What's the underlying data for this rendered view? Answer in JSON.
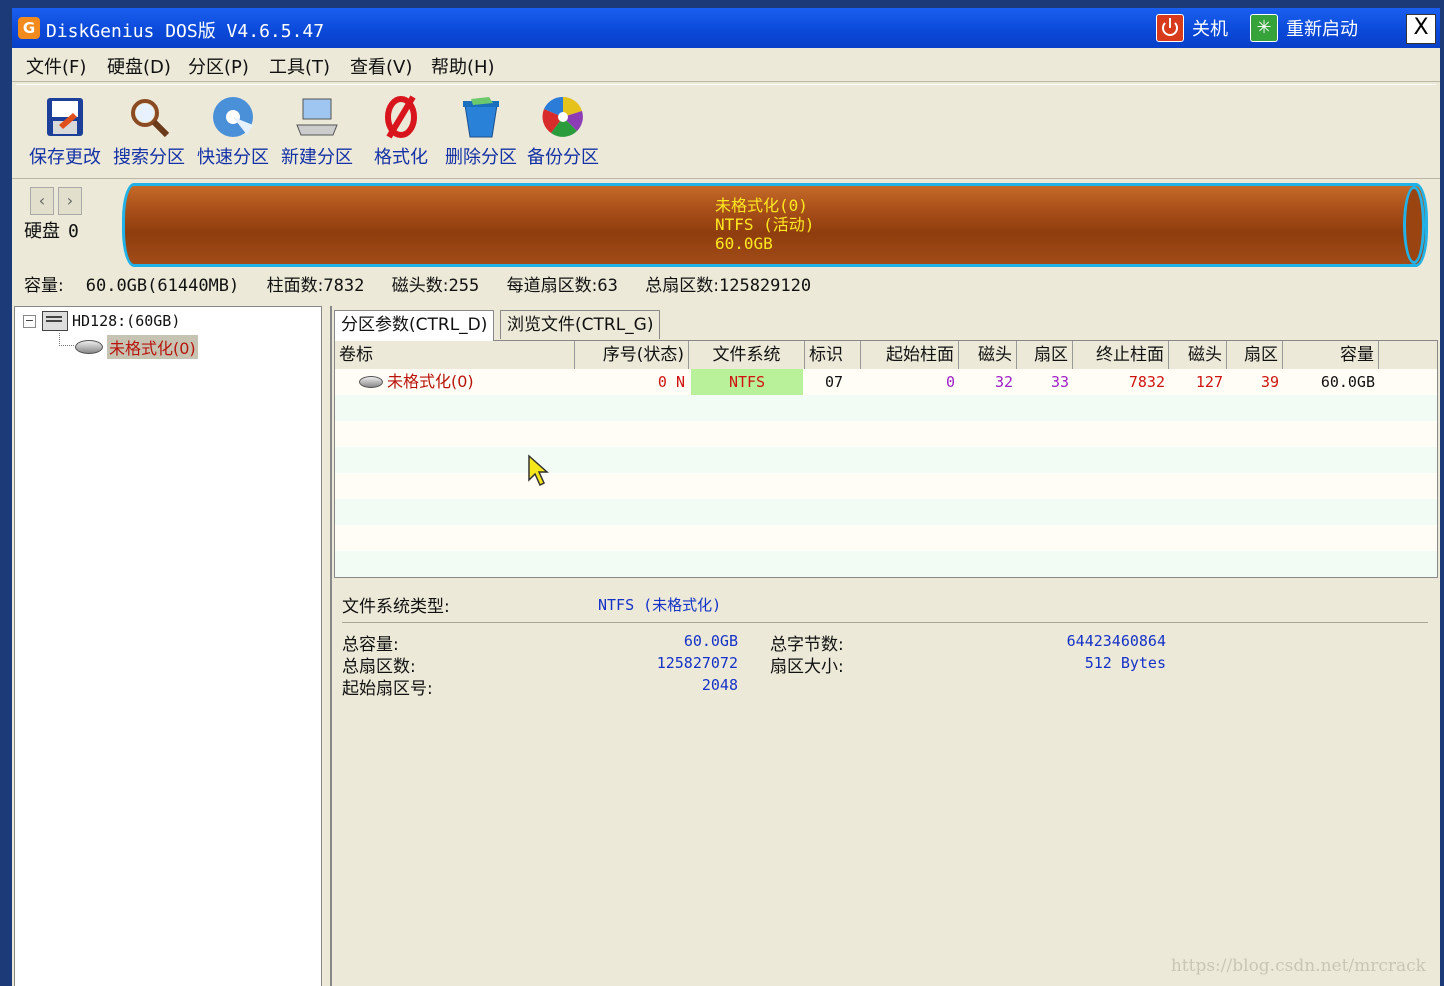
{
  "window": {
    "title": "DiskGenius DOS版 V4.6.5.47",
    "app_icon": "G",
    "shutdown_label": "关机",
    "restart_label": "重新启动",
    "close_label": "X"
  },
  "menu": [
    "文件(F)",
    "硬盘(D)",
    "分区(P)",
    "工具(T)",
    "查看(V)",
    "帮助(H)"
  ],
  "toolbar": [
    {
      "icon": "save-icon",
      "label": "保存更改"
    },
    {
      "icon": "search-partition-icon",
      "label": "搜索分区"
    },
    {
      "icon": "quick-partition-icon",
      "label": "快速分区"
    },
    {
      "icon": "new-partition-icon",
      "label": "新建分区"
    },
    {
      "icon": "format-icon",
      "label": "格式化"
    },
    {
      "icon": "delete-partition-icon",
      "label": "删除分区"
    },
    {
      "icon": "backup-partition-icon",
      "label": "备份分区"
    }
  ],
  "disk": {
    "label": "硬盘",
    "number": "0",
    "prev_arrow": "‹",
    "next_arrow": "›",
    "bar_line1": "未格式化(0)",
    "bar_line2": "NTFS (活动)",
    "bar_line3": "60.0GB",
    "info": {
      "capacity_label": "容量:",
      "capacity": "60.0GB(61440MB)",
      "cylinders_label": "柱面数:",
      "cylinders": "7832",
      "heads_label": "磁头数:",
      "heads": "255",
      "sectors_per_track_label": "每道扇区数:",
      "sectors_per_track": "63",
      "total_sectors_label": "总扇区数:",
      "total_sectors": "125829120"
    }
  },
  "tree": {
    "disk_node": "HD128:(60GB)",
    "partition_node": "未格式化(0)"
  },
  "tabs": [
    "分区参数(CTRL_D)",
    "浏览文件(CTRL_G)"
  ],
  "table": {
    "headers": [
      "卷标",
      "序号(状态)",
      "文件系统",
      "标识",
      "起始柱面",
      "磁头",
      "扇区",
      "终止柱面",
      "磁头",
      "扇区",
      "容量"
    ],
    "row": {
      "label": "未格式化(0)",
      "seq": "0 N",
      "fs": "NTFS",
      "id": "07",
      "start_cyl": "0",
      "start_head": "32",
      "start_sector": "33",
      "end_cyl": "7832",
      "end_head": "127",
      "end_sector": "39",
      "capacity": "60.0GB"
    }
  },
  "details": {
    "fs_type_label": "文件系统类型:",
    "fs_type": "NTFS (未格式化)",
    "total_capacity_label": "总容量:",
    "total_capacity": "60.0GB",
    "total_sectors_label": "总扇区数:",
    "total_sectors": "125827072",
    "start_sector_label": "起始扇区号:",
    "start_sector": "2048",
    "total_bytes_label": "总字节数:",
    "total_bytes": "64423460864",
    "sector_size_label": "扇区大小:",
    "sector_size": "512 Bytes"
  },
  "watermark": "https://blog.csdn.net/mrcrack",
  "colors": {
    "titlebar": "#0a48d8",
    "window_bg": "#ece9d8",
    "partition_bar": "#a9501a",
    "partition_border": "#21b2e8",
    "bar_text": "#ffe820",
    "value_blue": "#1432c8",
    "fs_highlight": "#b9f09a",
    "selected_red": "#b8140c"
  }
}
